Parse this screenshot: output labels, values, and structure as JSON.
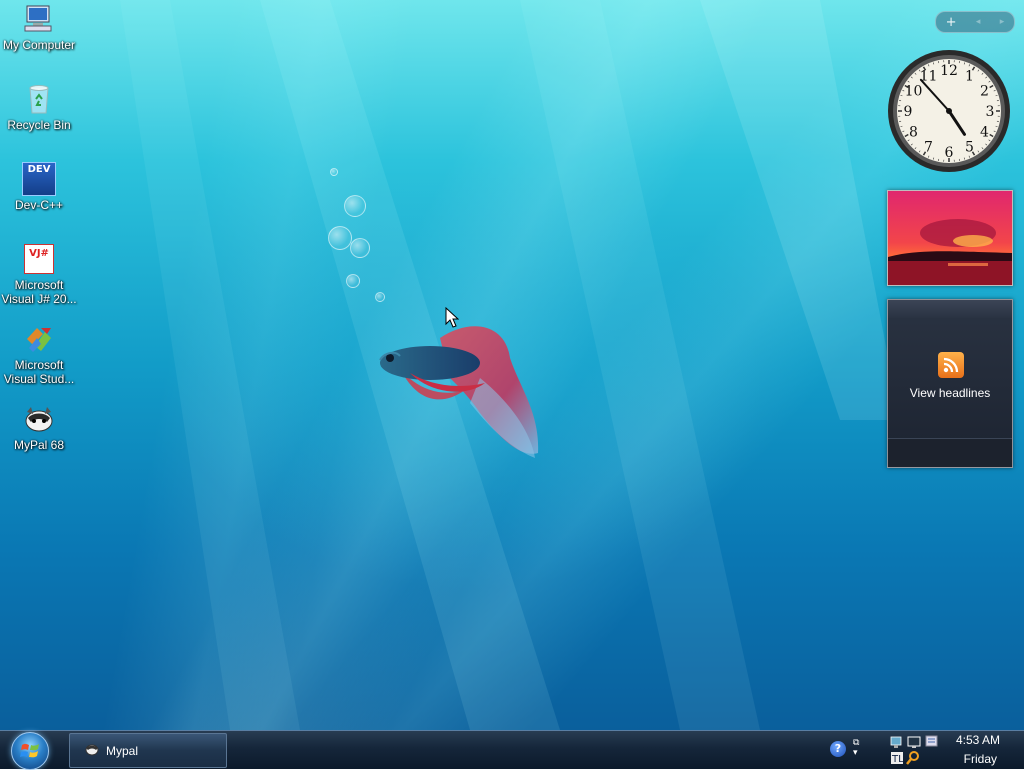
{
  "desktop": {
    "icons": [
      {
        "label": "My Computer",
        "icon": "computer-icon"
      },
      {
        "label": "Recycle Bin",
        "icon": "recycle-bin-icon"
      },
      {
        "label": "Dev-C++",
        "icon": "dev-cpp-icon"
      },
      {
        "label": "Microsoft\nVisual J# 20...",
        "icon": "visual-jsharp-icon"
      },
      {
        "label": "Microsoft\nVisual Stud...",
        "icon": "visual-studio-icon"
      },
      {
        "label": "MyPal 68",
        "icon": "mypal-icon"
      }
    ],
    "wallpaper": "betta-fish",
    "dev_badge": "DEV",
    "vj_badge": "VJ#"
  },
  "sidebar": {
    "add_button": "+",
    "prev_button": "◂",
    "next_button": "▸",
    "clock": {
      "numerals": [
        "12",
        "1",
        "2",
        "3",
        "4",
        "5",
        "6",
        "7",
        "8",
        "9",
        "10",
        "11"
      ],
      "hour": 4,
      "minute": 53
    },
    "slideshow": {
      "image": "red-sunset-over-sea"
    },
    "feed": {
      "label": "View headlines",
      "icon": "rss-feed-icon"
    }
  },
  "taskbar": {
    "start_icon": "windows-logo-icon",
    "tasks": [
      {
        "label": "Mypal",
        "icon": "mypal-icon"
      }
    ],
    "tray": {
      "help_label": "?",
      "restore_glyph": "⧉",
      "time": "4:53 AM",
      "day": "Friday"
    }
  },
  "colors": {
    "wallpaper_top": "#6fe6ec",
    "wallpaper_bottom": "#0a5f9c",
    "taskbar": "#15263a",
    "feed_orange": "#f08a2a"
  }
}
